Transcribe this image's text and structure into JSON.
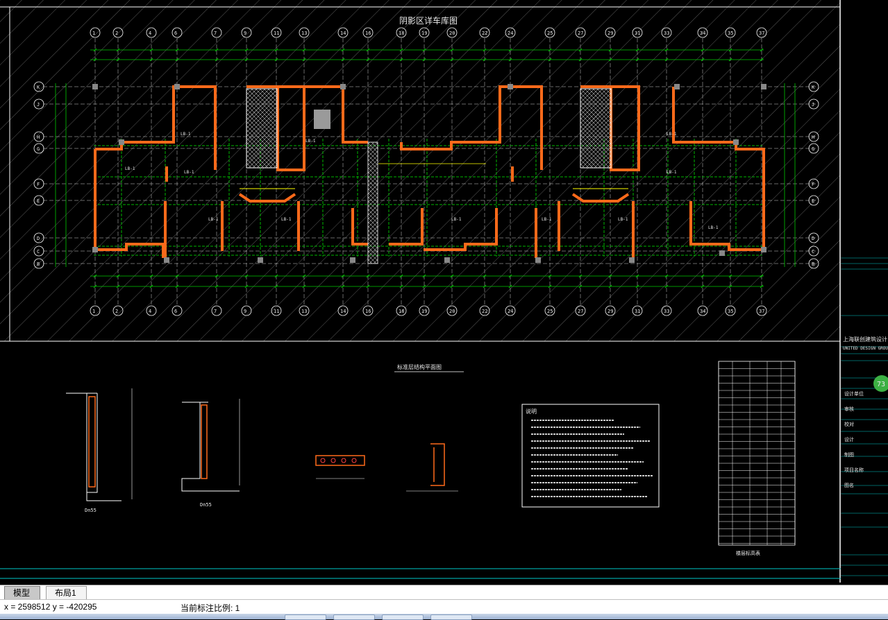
{
  "drawing": {
    "plan_title": "阴影区详车库图",
    "section_title": "标准层结构平面图",
    "detail_labels": [
      "Dn55",
      "Dn55"
    ],
    "notes_header": "说明",
    "table_caption": "楼层标高表"
  },
  "title_block": {
    "firm_cn": "上海联创建筑设计",
    "firm_en": "UNITED DESIGN GROUP",
    "stamp": "73",
    "field_labels": [
      "设计单位",
      "审核",
      "校对",
      "设计",
      "制图",
      "项目名称",
      "图名"
    ]
  },
  "tabs": [
    {
      "label": "模型",
      "active": true
    },
    {
      "label": "布局1",
      "active": false
    }
  ],
  "status": {
    "coords": "x = 2598512 y = -420295",
    "scale_label": "当前标注比例: 1"
  },
  "colors": {
    "background": "#000000",
    "wall": "#ff6a1a",
    "grid_bubble": "#ffffff",
    "dimension": "#00c800",
    "hatch": "#ffffff",
    "cyan": "#00c8c8",
    "yellow": "#ffff00"
  }
}
